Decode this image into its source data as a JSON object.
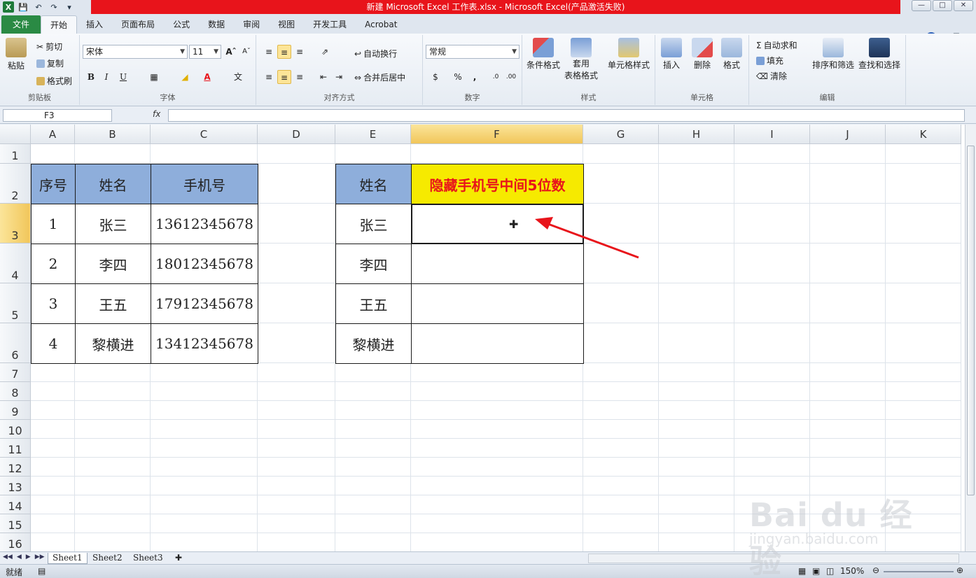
{
  "window": {
    "title": "新建 Microsoft Excel 工作表.xlsx  -  Microsoft Excel(产品激活失败)"
  },
  "ribbon_tabs": [
    "开始",
    "插入",
    "页面布局",
    "公式",
    "数据",
    "审阅",
    "视图",
    "开发工具",
    "Acrobat"
  ],
  "file_tab": "文件",
  "clipboard": {
    "paste": "粘贴",
    "cut": "剪切",
    "copy": "复制",
    "format_painter": "格式刷",
    "label": "剪贴板"
  },
  "font": {
    "name": "宋体",
    "size": "11",
    "bold": "B",
    "italic": "I",
    "underline": "U",
    "label": "字体"
  },
  "alignment": {
    "wrap": "自动换行",
    "merge": "合并后居中",
    "label": "对齐方式"
  },
  "number": {
    "format": "常规",
    "currency": "$",
    "percent": "%",
    "comma": ",",
    "label": "数字"
  },
  "styles": {
    "conditional": "条件格式",
    "table_line1": "套用",
    "table_line2": "表格格式",
    "cell_styles": "单元格样式",
    "label": "样式"
  },
  "cells": {
    "insert": "插入",
    "delete": "删除",
    "format": "格式",
    "label": "单元格"
  },
  "editing": {
    "autosum": "自动求和",
    "fill": "填充",
    "clear": "清除",
    "sort_filter": "排序和筛选",
    "find_select": "查找和选择",
    "label": "编辑"
  },
  "formula_bar": {
    "name_box": "F3",
    "fx": "fx",
    "value": ""
  },
  "columns": [
    "A",
    "B",
    "C",
    "D",
    "E",
    "F",
    "G",
    "H",
    "I",
    "J",
    "K"
  ],
  "rows": [
    "1",
    "2",
    "3",
    "4",
    "5",
    "6",
    "7",
    "8",
    "9",
    "10",
    "11",
    "12",
    "13",
    "14",
    "15",
    "16"
  ],
  "selected_cell": "F3",
  "table1": {
    "headers": [
      "序号",
      "姓名",
      "手机号"
    ],
    "rows": [
      [
        "1",
        "张三",
        "13612345678"
      ],
      [
        "2",
        "李四",
        "18012345678"
      ],
      [
        "3",
        "王五",
        "17912345678"
      ],
      [
        "4",
        "黎横进",
        "13412345678"
      ]
    ]
  },
  "table2": {
    "headers": [
      "姓名",
      "隐藏手机号中间5位数"
    ],
    "rows": [
      [
        "张三",
        ""
      ],
      [
        "李四",
        ""
      ],
      [
        "王五",
        ""
      ],
      [
        "黎横进",
        ""
      ]
    ]
  },
  "sheets": [
    "Sheet1",
    "Sheet2",
    "Sheet3"
  ],
  "active_sheet": "Sheet1",
  "status": {
    "ready": "就绪",
    "zoom": "150%"
  },
  "watermark": {
    "brand": "Bai du 经验",
    "url": "jingyan.baidu.com"
  },
  "colors": {
    "header_fill": "#8eaedb",
    "highlight_fill": "#f6ea00",
    "highlight_text": "#e8141b",
    "title_bar": "#e8141b",
    "file_tab": "#2a8a44"
  }
}
